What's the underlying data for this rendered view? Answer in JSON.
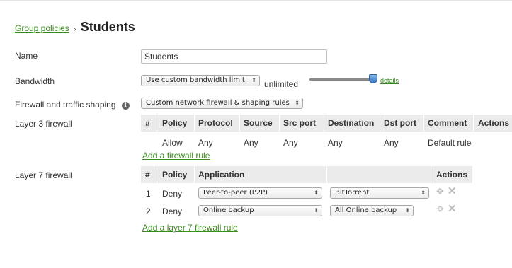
{
  "breadcrumb": {
    "parent": "Group policies",
    "separator": "›",
    "current": "Students"
  },
  "form": {
    "name_label": "Name",
    "name_value": "Students",
    "bandwidth_label": "Bandwidth",
    "bandwidth_select": "Use custom bandwidth limit",
    "bandwidth_value": "unlimited",
    "bandwidth_slider_level": 1.0,
    "details_link": "details",
    "firewall_label": "Firewall and traffic shaping",
    "firewall_info_icon": "info-icon",
    "firewall_select": "Custom network firewall & shaping rules"
  },
  "layer3": {
    "label": "Layer 3 firewall",
    "columns": [
      "#",
      "Policy",
      "Protocol",
      "Source",
      "Src port",
      "Destination",
      "Dst port",
      "Comment",
      "Actions"
    ],
    "rows": [
      {
        "num": "",
        "policy": "Allow",
        "protocol": "Any",
        "source": "Any",
        "src_port": "Any",
        "destination": "Any",
        "dst_port": "Any",
        "comment": "Default rule"
      }
    ],
    "add_link": "Add a firewall rule"
  },
  "layer7": {
    "label": "Layer 7 firewall",
    "columns": [
      "#",
      "Policy",
      "Application",
      "",
      "Actions"
    ],
    "rows": [
      {
        "num": "1",
        "policy": "Deny",
        "application": "Peer-to-peer (P2P)",
        "detail": "BitTorrent"
      },
      {
        "num": "2",
        "policy": "Deny",
        "application": "Online backup",
        "detail": "All Online backup"
      }
    ],
    "add_link": "Add a layer 7 firewall rule"
  },
  "icons": {
    "move": "move-icon",
    "delete": "delete-icon",
    "select_arrow": "updown-arrow-icon"
  },
  "colors": {
    "link": "#3a8a1e",
    "header_bg": "#ebebeb",
    "slider_thumb": "#3b79c4"
  }
}
